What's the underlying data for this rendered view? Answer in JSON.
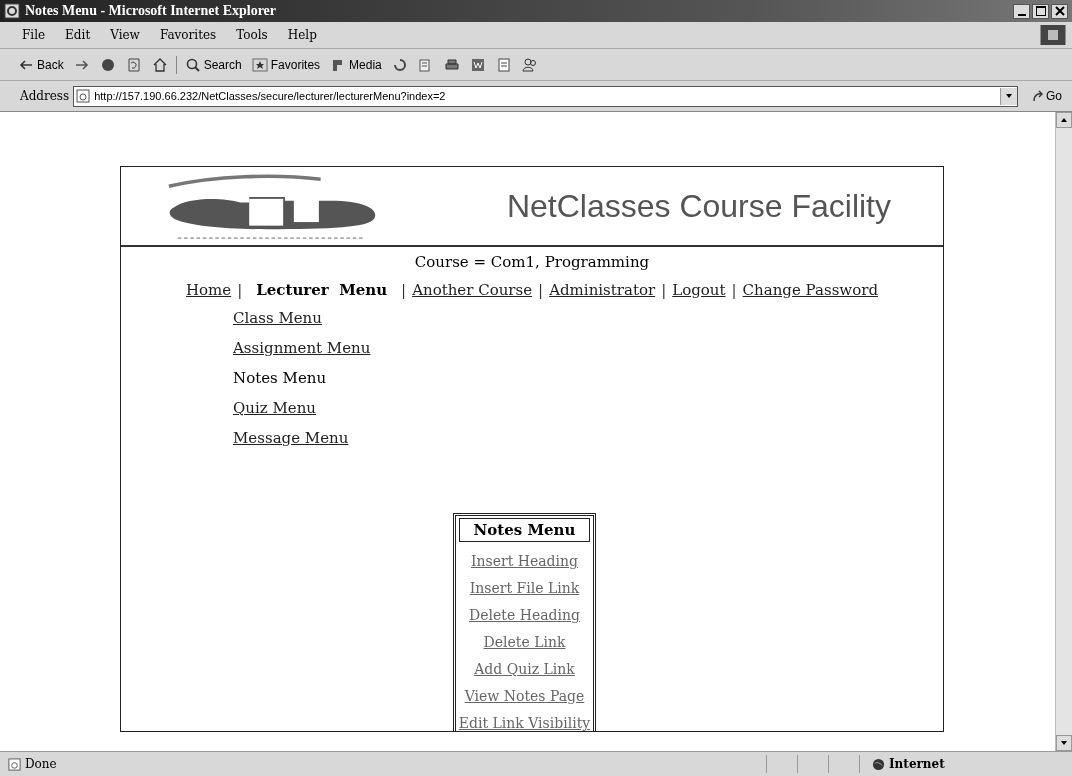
{
  "window": {
    "title": "Notes Menu - Microsoft Internet Explorer"
  },
  "menu_bar": [
    "File",
    "Edit",
    "View",
    "Favorites",
    "Tools",
    "Help"
  ],
  "toolbar": [
    {
      "kind": "back",
      "label": "Back"
    },
    {
      "kind": "forward"
    },
    {
      "kind": "stop"
    },
    {
      "kind": "refresh"
    },
    {
      "kind": "home"
    },
    {
      "kind": "search",
      "label": "Search"
    },
    {
      "kind": "favorites",
      "label": "Favorites"
    },
    {
      "kind": "media",
      "label": "Media"
    },
    {
      "kind": "history"
    },
    {
      "kind": "mail"
    },
    {
      "kind": "print"
    },
    {
      "kind": "edit"
    },
    {
      "kind": "discuss"
    },
    {
      "kind": "messenger"
    }
  ],
  "address_bar": {
    "label": "Address",
    "url": "http://157.190.66.232/NetClasses/secure/lecturer/lecturerMenu?index=2",
    "go": "Go"
  },
  "page": {
    "site_title": "NetClasses Course Facility",
    "course": "Course = Com1, Programming",
    "nav": [
      {
        "kind": "link",
        "label": "Home",
        "selected": false
      },
      {
        "kind": "separator",
        "label": "|"
      },
      {
        "kind": "link",
        "label": "Lecturer  Menu",
        "selected": true
      },
      {
        "kind": "separator",
        "label": "|"
      },
      {
        "kind": "link",
        "label": "Another Course",
        "selected": false
      },
      {
        "kind": "separator",
        "label": "|"
      },
      {
        "kind": "link",
        "label": "Administrator",
        "selected": false
      },
      {
        "kind": "separator",
        "label": "|"
      },
      {
        "kind": "link",
        "label": "Logout",
        "selected": false
      },
      {
        "kind": "separator",
        "label": "|"
      },
      {
        "kind": "link",
        "label": "Change Password",
        "selected": false
      }
    ],
    "side_menu": [
      {
        "label": "Class Menu",
        "selected": false
      },
      {
        "label": "Assignment Menu",
        "selected": false
      },
      {
        "label": "Notes Menu",
        "selected": true
      },
      {
        "label": "Quiz Menu",
        "selected": false
      },
      {
        "label": "Message Menu",
        "selected": false
      }
    ],
    "notes_menu": {
      "title": "Notes Menu",
      "items": [
        "Insert Heading",
        "Insert File Link",
        "Delete Heading",
        "Delete Link",
        "Add Quiz Link",
        "View Notes Page",
        "Edit Link Visibility"
      ]
    }
  },
  "status_bar": {
    "text": "Done",
    "zone": "Internet"
  }
}
